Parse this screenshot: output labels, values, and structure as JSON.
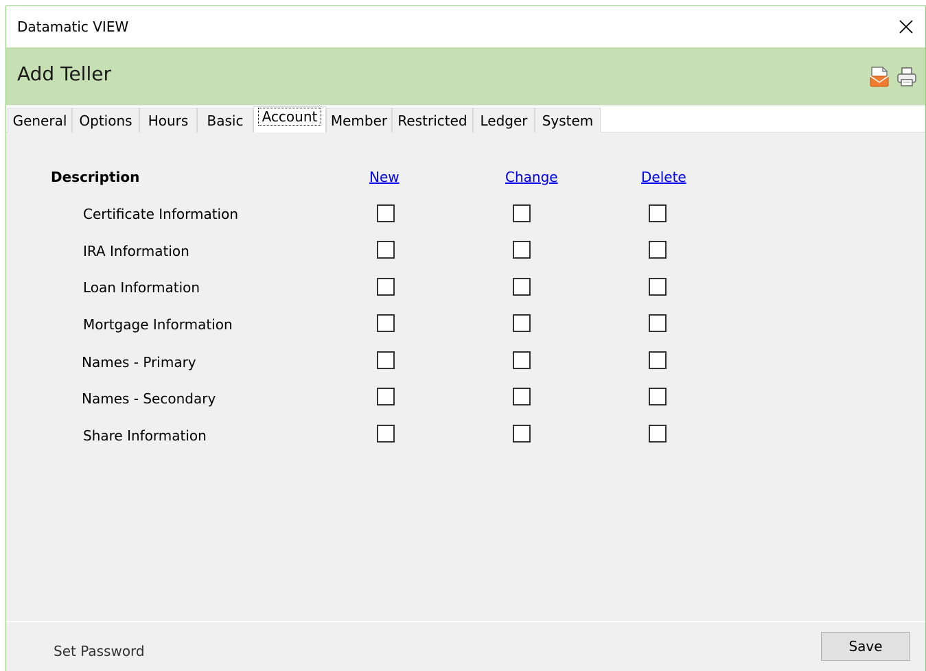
{
  "window": {
    "title": "Datamatic VIEW"
  },
  "header": {
    "title": "Add Teller"
  },
  "tabs": [
    {
      "label": "General"
    },
    {
      "label": "Options"
    },
    {
      "label": "Hours"
    },
    {
      "label": "Basic"
    },
    {
      "label": "Account"
    },
    {
      "label": "Member"
    },
    {
      "label": "Restricted"
    },
    {
      "label": "Ledger"
    },
    {
      "label": "System"
    }
  ],
  "active_tab": "Account",
  "permissions": {
    "description_header": "Description",
    "new_header": "New",
    "change_header": "Change",
    "delete_header": "Delete",
    "rows": [
      {
        "label": "Certificate Information",
        "new": false,
        "change": false,
        "delete": false
      },
      {
        "label": "IRA Information",
        "new": false,
        "change": false,
        "delete": false
      },
      {
        "label": "Loan Information",
        "new": false,
        "change": false,
        "delete": false
      },
      {
        "label": "Mortgage Information",
        "new": false,
        "change": false,
        "delete": false
      },
      {
        "label": "Names - Primary",
        "new": false,
        "change": false,
        "delete": false
      },
      {
        "label": "Names - Secondary",
        "new": false,
        "change": false,
        "delete": false
      },
      {
        "label": "Share Information",
        "new": false,
        "change": false,
        "delete": false
      }
    ]
  },
  "footer": {
    "set_password_label": "Set Password",
    "save_label": "Save"
  },
  "icons": {
    "close": "close-icon",
    "mail": "mail-icon",
    "print": "print-icon"
  },
  "colors": {
    "header_bg": "#c6e0b4",
    "window_border": "#8cc97a",
    "link": "#0000ee"
  }
}
